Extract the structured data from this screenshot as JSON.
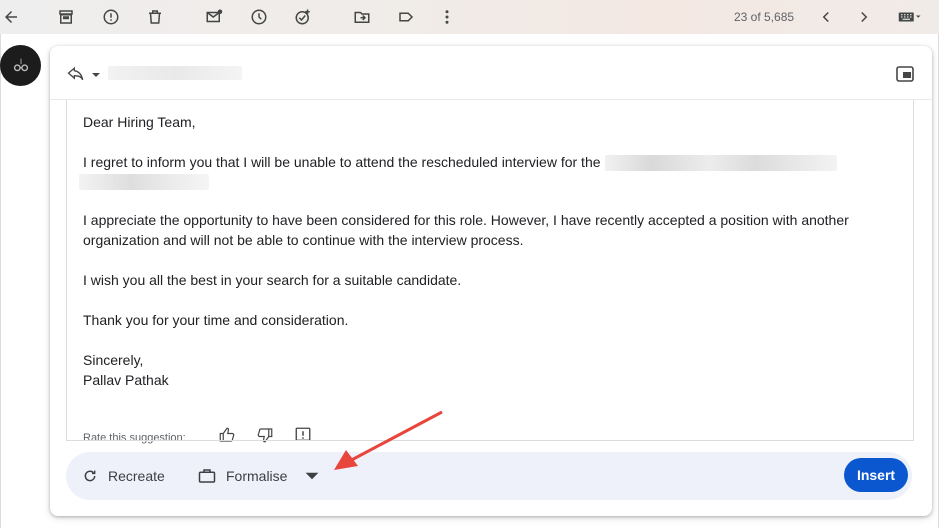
{
  "toolbar": {
    "icons": [
      "back-arrow-icon",
      "archive-icon",
      "report-spam-icon",
      "delete-icon",
      "mark-unread-icon",
      "snooze-icon",
      "add-task-icon",
      "move-to-icon",
      "label-icon",
      "more-icon"
    ],
    "pager": "23 of 5,685"
  },
  "compose": {
    "greeting": "Dear Hiring Team,",
    "para1": "I regret to inform you that I will be unable to attend the rescheduled interview for the",
    "para2": "I appreciate the opportunity to have been considered for this role. However, I have recently accepted a position with another organization and will not be able to continue with the interview process.",
    "para3": "I wish you all the best in your search for a suitable candidate.",
    "para4": "Thank you for your time and consideration.",
    "closing": "Sincerely,",
    "signature": "Pallav Pathak",
    "rate_label": "Rate this suggestion:"
  },
  "actions": {
    "recreate": "Recreate",
    "formalise": "Formalise",
    "insert": "Insert"
  },
  "colors": {
    "insert_bg": "#0b57d0",
    "action_bar_bg": "#eef1fa",
    "annotation_red": "#e8453c"
  }
}
